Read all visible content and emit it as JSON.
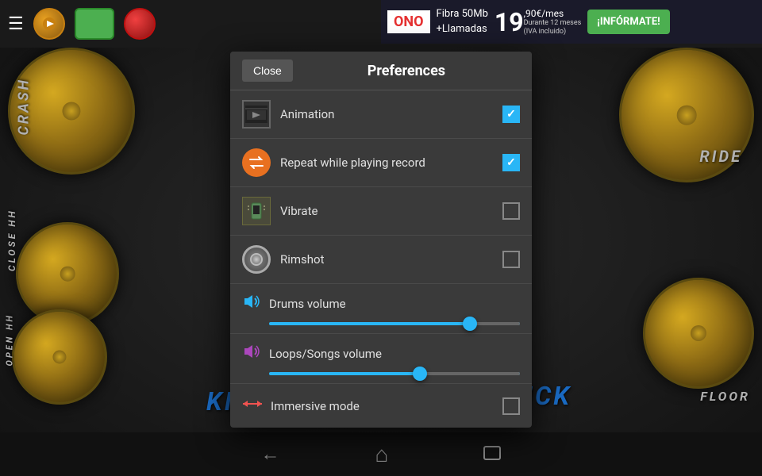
{
  "topBar": {
    "hamburger": "☰",
    "buttons": [
      "record",
      "green",
      "record-red"
    ]
  },
  "ad": {
    "brand": "ONO",
    "line1": "Fibra 50Mb",
    "line2": "+Llamadas",
    "price_int": "19",
    "price_dec": ",90€/mes",
    "price_note": "Durante 12 meses",
    "price_note2": "(IVA incluido)",
    "cta": "¡INFÓRMATE!"
  },
  "drumLabels": {
    "crash": "CRASH",
    "closeHH": "CLOSE HH",
    "openHH": "OPEN HH",
    "ride": "RIDE",
    "floor": "FLOOR",
    "kick1": "KICK",
    "kick2": "KICK"
  },
  "preferences": {
    "title": "Preferences",
    "closeLabel": "Close",
    "items": [
      {
        "id": "animation",
        "label": "Animation",
        "type": "checkbox",
        "checked": true
      },
      {
        "id": "repeat",
        "label": "Repeat while playing record",
        "type": "checkbox",
        "checked": true
      },
      {
        "id": "vibrate",
        "label": "Vibrate",
        "type": "checkbox",
        "checked": false
      },
      {
        "id": "rimshot",
        "label": "Rimshot",
        "type": "checkbox",
        "checked": false
      }
    ],
    "sliders": [
      {
        "id": "drums-volume",
        "label": "Drums volume",
        "value": 80,
        "iconType": "blue"
      },
      {
        "id": "loops-volume",
        "label": "Loops/Songs volume",
        "value": 60,
        "iconType": "purple"
      }
    ],
    "immersive": {
      "label": "Immersive mode",
      "checked": false
    }
  },
  "bottomNav": {
    "back": "←",
    "home": "⌂",
    "recent": "▭"
  }
}
